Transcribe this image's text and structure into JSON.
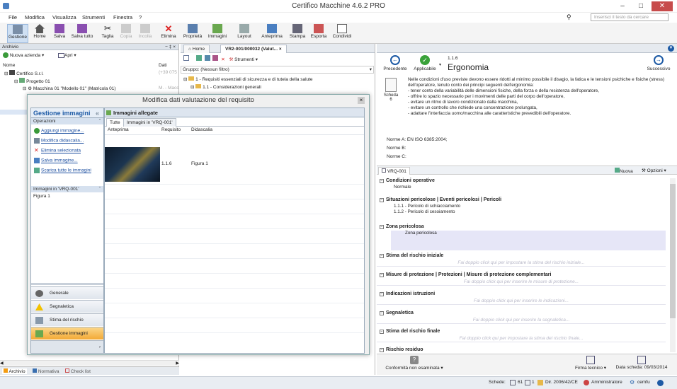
{
  "window": {
    "title": "Certifico Macchine 4.6.2 PRO"
  },
  "menu": {
    "items": [
      "File",
      "Modifica",
      "Visualizza",
      "Strumenti",
      "Finestra",
      "?"
    ],
    "search_placeholder": "Inserisci il testo da cercare"
  },
  "toolbar": {
    "buttons": [
      "Gestione",
      "Home",
      "Salva",
      "Salva tutto",
      "Taglia",
      "Copia",
      "Incolla",
      "Elimina",
      "Proprietà",
      "Immagini",
      "Layout",
      "Anteprima",
      "Stampa",
      "Esporta",
      "Condividi"
    ]
  },
  "archive": {
    "header": "Archivio",
    "new_company": "Nuova azienda",
    "open": "Apri",
    "col_name": "Nome",
    "col_data": "Dati",
    "tree": [
      "Certifico S.r.l.",
      "Progetto 01",
      "Macchina 01 \"Modello 01\" (Matricola 01)"
    ],
    "tree_data": [
      "(+39 075",
      "",
      "M. - Macc"
    ],
    "bottom_tabs": [
      "Archivio",
      "Normativa",
      "Check list"
    ]
  },
  "doctabs": {
    "home": "Home",
    "current": "VR2-001/000032 (Valut..."
  },
  "mid": {
    "tools_label": "Strumenti",
    "group_filter": "Gruppo: (Nessun filtro)",
    "tree": [
      "1 - Requisiti essenziali di sicurezza e di tutela della salute",
      "1.1 - Considerazioni generali"
    ]
  },
  "dialog": {
    "title": "Modifica dati valutazione del requisito",
    "left_title": "Gestione immagini",
    "operations_header": "Operazioni",
    "operations": [
      "Aggiungi immagine...",
      "Modifica didascalia...",
      "Elimina selezionata",
      "Salva immagine...",
      "Scarica tutte le immagini"
    ],
    "images_in_header": "Immagini in 'VRQ-001'",
    "images_in_list": [
      "Figura 1"
    ],
    "nav": [
      "Generale",
      "Segnaletica",
      "Stima del rischio",
      "Gestione immagini"
    ],
    "right_title": "Immagini allegate",
    "tabs": [
      "Tutte",
      "Immagini in 'VRQ-001'"
    ],
    "columns": [
      "Anteprima",
      "Requisito",
      "Didascalia"
    ],
    "rows": [
      {
        "requisito": "1.1.6",
        "didascalia": "Figura 1"
      }
    ]
  },
  "right": {
    "prev": "Precedente",
    "applicable": "Applicabile",
    "next": "Successivo",
    "code": "1.1.6",
    "title": "Ergonomia",
    "sheet_label": "Scheda",
    "sheet_num": "6",
    "description": "Nelle condizioni d'uso previste devono essere ridotti al minimo possibile il disagio, la fatica e le tensioni psichiche e fisiche (stress) dell'operatore, tenuto conto dei principi seguenti dell'ergonomia:\n- tener conto della variabilità delle dimensioni fisiche, della forza e della resistenza dell'operatore,\n- offrire lo spazio necessario per i movimenti delle parti del corpo dell'operatore,\n- evitare un ritmo di lavoro condizionato dalla macchina,\n- evitare un controllo che richiede una concentrazione prolungata,\n- adattare l'interfaccia uomo/macchina alle caratteristiche prevedibili dell'operatore.",
    "norm_a": "Norme A: EN ISO 6385:2004;",
    "norm_b": "Norme B:",
    "norm_c": "Norme C:",
    "vrq_tab": "VRQ-001",
    "new_label": "Nuova",
    "options_label": "Opzioni",
    "sections": [
      {
        "title": "Condizioni operative",
        "content": "Normale",
        "hint": ""
      },
      {
        "title": "Situazioni pericolose | Eventi pericolosi | Pericoli",
        "content": "1.1.1 - Pericolo di schiacciamento\n1.1.2 - Pericolo di cesoiamento",
        "hint": ""
      },
      {
        "title": "Zona pericolosa",
        "content": "Zona pericolosa",
        "hint": ""
      },
      {
        "title": "Stima del rischio iniziale",
        "content": "",
        "hint": "Fai doppio click qui per impostare la stima del rischio iniziale..."
      },
      {
        "title": "Misure di protezione | Protezioni | Misure di protezione complementari",
        "content": "",
        "hint": "Fai doppio click qui per inserire le misure di protezione..."
      },
      {
        "title": "Indicazioni istruzioni",
        "content": "",
        "hint": "Fai doppio click qui per inserire le indicazioni..."
      },
      {
        "title": "Segnaletica",
        "content": "",
        "hint": "Fai doppio click qui per inserire la segnaletica..."
      },
      {
        "title": "Stima del rischio finale",
        "content": "",
        "hint": "Fai doppio click qui per impostare la stima del rischio finale..."
      },
      {
        "title": "Rischio residuo",
        "content": "",
        "hint": ""
      }
    ],
    "bottom_conformity": "Conformità non esaminata",
    "bottom_signature": "Firma tecnico",
    "bottom_date": "Data scheda: 09/03/2014"
  },
  "status": {
    "sheets_label": "Schede:",
    "sheets_count": "61",
    "sheets_count2": "1",
    "directive": "Dir. 2006/42/CE",
    "role": "Amministratore",
    "user": "cemfu"
  }
}
